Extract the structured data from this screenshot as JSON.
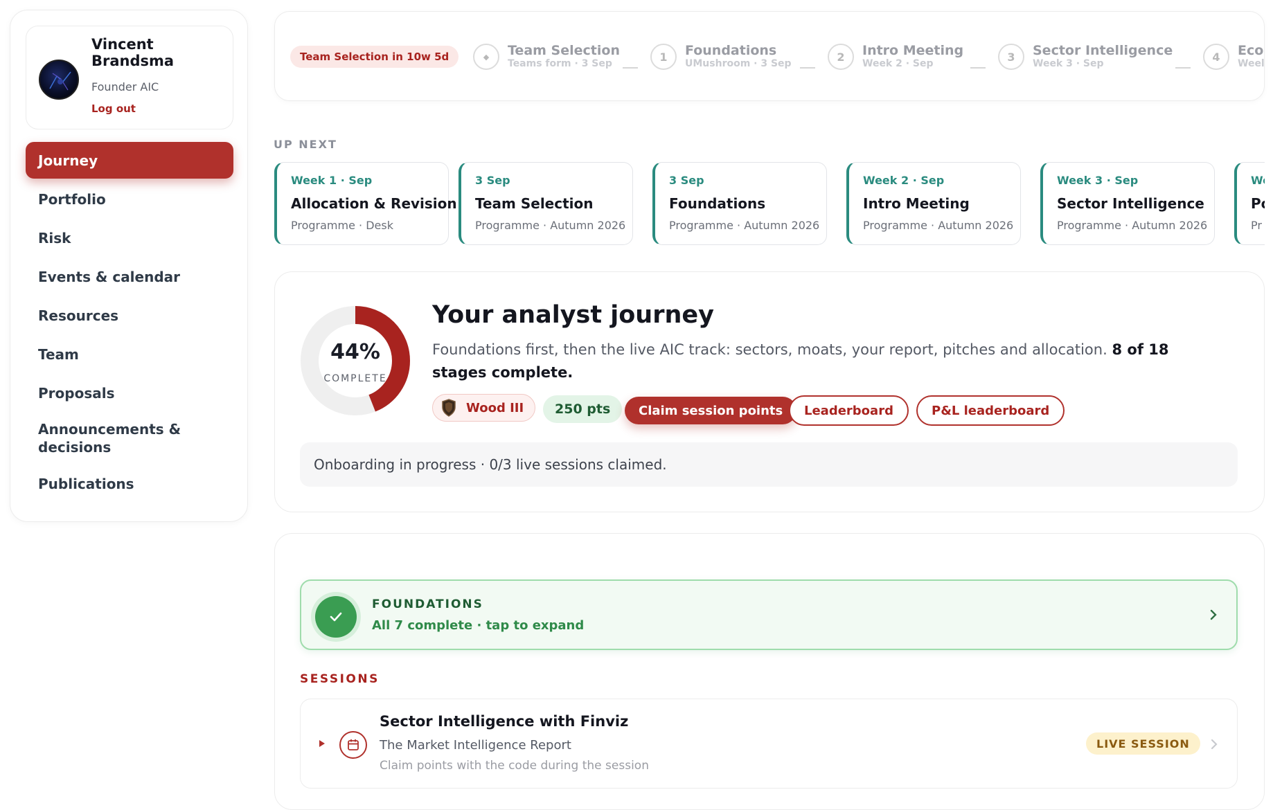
{
  "profile": {
    "name": "Vincent Brandsma",
    "role": "Founder AIC",
    "logout": "Log out"
  },
  "nav": {
    "items": [
      {
        "label": "Journey",
        "active": true
      },
      {
        "label": "Portfolio"
      },
      {
        "label": "Risk"
      },
      {
        "label": "Events & calendar"
      },
      {
        "label": "Resources"
      },
      {
        "label": "Team"
      },
      {
        "label": "Proposals"
      },
      {
        "label": "Announcements & decisions"
      },
      {
        "label": "Publications"
      }
    ]
  },
  "stepper": {
    "countdown": "Team Selection in 10w 5d",
    "steps": [
      {
        "marker": "◆",
        "title": "Team Selection",
        "sub": "Teams form · 3 Sep"
      },
      {
        "marker": "1",
        "title": "Foundations",
        "sub": "UMushroom · 3 Sep"
      },
      {
        "marker": "2",
        "title": "Intro Meeting",
        "sub": "Week 2 · Sep"
      },
      {
        "marker": "3",
        "title": "Sector Intelligence",
        "sub": "Week 3 · Sep"
      },
      {
        "marker": "4",
        "title": "Eco",
        "sub": "Weel"
      }
    ]
  },
  "upnext": {
    "label": "UP NEXT",
    "cards": [
      {
        "date": "Week 1 · Sep",
        "title": "Allocation & Revision",
        "sub": "Programme · Desk"
      },
      {
        "date": "3 Sep",
        "title": "Team Selection",
        "sub": "Programme · Autumn 2026"
      },
      {
        "date": "3 Sep",
        "title": "Foundations",
        "sub": "Programme · Autumn 2026"
      },
      {
        "date": "Week 2 · Sep",
        "title": "Intro Meeting",
        "sub": "Programme · Autumn 2026"
      },
      {
        "date": "Week 3 · Sep",
        "title": "Sector Intelligence",
        "sub": "Programme · Autumn 2026"
      },
      {
        "date": "We",
        "title": "Po",
        "sub": "Pr"
      }
    ]
  },
  "journey": {
    "progress_fraction": 0.44,
    "percent_label": "44%",
    "complete_label": "COMPLETE",
    "title": "Your analyst journey",
    "desc": "Foundations first, then the live AIC track: sectors, moats, your report, pitches and allocation.",
    "desc_bold": "8 of 18 stages complete.",
    "rank": "Wood III",
    "points": "250 pts",
    "claim_button": "Claim session points",
    "leaderboard_button": "Leaderboard",
    "pl_leaderboard_button": "P&L leaderboard",
    "status": "Onboarding in progress · 0/3 live sessions claimed.",
    "colors": {
      "accent": "#b0312c",
      "teal": "#2a8b7f",
      "green": "#3a9d52"
    }
  },
  "foundations": {
    "title": "FOUNDATIONS",
    "sub": "All 7 complete · tap to expand"
  },
  "sessions": {
    "label": "SESSIONS",
    "items": [
      {
        "title": "Sector Intelligence with Finviz",
        "sub": "The Market Intelligence Report",
        "note": "Claim points with the code during the session",
        "badge": "LIVE SESSION",
        "icon": "calendar-icon"
      }
    ]
  }
}
